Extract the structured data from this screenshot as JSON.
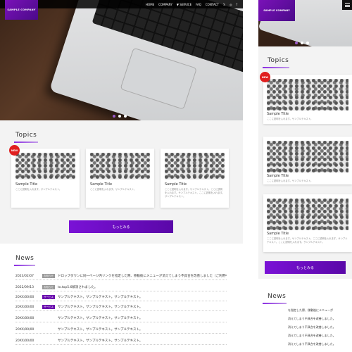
{
  "brand": "SAMPLE COMPANY",
  "nav": [
    "HOME",
    "COMPANY",
    "▼ SERVICE",
    "FAQ",
    "CONTACT"
  ],
  "social": [
    "twitter-icon",
    "instagram-icon",
    "facebook-icon"
  ],
  "topics": {
    "title": "Topics",
    "badge": "NEW",
    "cards": [
      {
        "title": "Sample Title",
        "desc": "ここに説明を入れます。サンプルテキスト。"
      },
      {
        "title": "Sample Title",
        "desc": "ここに説明を入れます。サンプルテキスト。"
      },
      {
        "title": "Sample Title",
        "desc": "ここに説明を入れます。サンプルテキスト。ここに説明を入れます。サンプルテキスト。ここに説明を入れます。サンプルテキスト。"
      }
    ],
    "more": "もっとみる"
  },
  "news": {
    "title": "News",
    "items": [
      {
        "date": "2023/02/07",
        "tag": "お知らせ",
        "tagColor": "#999999",
        "text": "ドロップダウンに同一ページ内リンクを指定した際、移動後にメニューが消えてしまう不具合を改善しました（ご利用中の方は、最新のテンプレートのjsフォルダのmain.jsに入れ替えてください"
      },
      {
        "date": "2022/09/13",
        "tag": "お知らせ",
        "tagColor": "#999999",
        "text": "to.top5.6解消されました。"
      },
      {
        "date": "20XX/00/00",
        "tag": "サービス",
        "tagColor": "#6a0dad",
        "text": "サンプルテキスト。サンプルテキスト。サンプルテキスト。"
      },
      {
        "date": "20XX/00/00",
        "tag": "サービス",
        "tagColor": "#6a0dad",
        "text": "サンプルテキスト。サンプルテキスト。サンプルテキスト。"
      },
      {
        "date": "20XX/00/00",
        "tag": "",
        "tagColor": "",
        "text": "サンプルテキスト。サンプルテキスト。サンプルテキスト。"
      },
      {
        "date": "20XX/00/00",
        "tag": "",
        "tagColor": "",
        "text": "サンプルテキスト。サンプルテキスト。サンプルテキスト。"
      },
      {
        "date": "20XX/00/00",
        "tag": "",
        "tagColor": "",
        "text": "サンプルテキスト。サンプルテキスト。サンプルテキスト。"
      }
    ]
  },
  "mobile_news_lines": [
    "を指定した際、移動後にメニューが",
    "消えてしまう不具合を改善しました。",
    "消えてしまう不具合を改善しました。",
    "消えてしまう不具合を改善しました。",
    "消えてしまう不具合を改善しました。"
  ],
  "colors": {
    "accent": "#7a12d6",
    "badge": "#e02020"
  }
}
